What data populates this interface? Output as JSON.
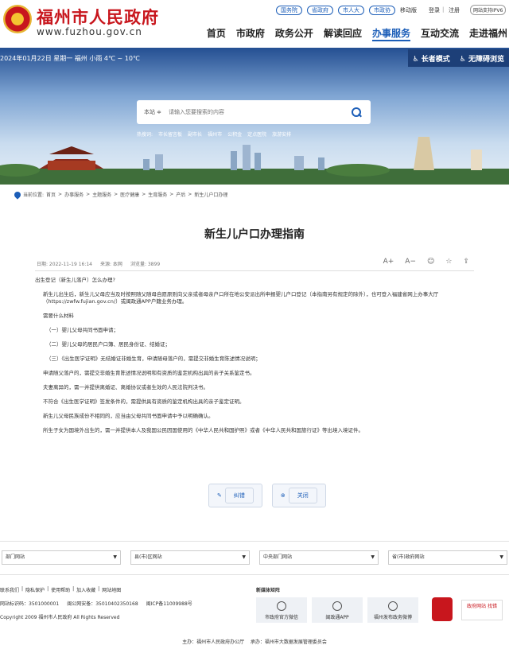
{
  "header": {
    "site_name": "福州市人民政府",
    "domain": "www.fuzhou.gov.cn",
    "ext_links": [
      "国务院",
      "省政府",
      "市人大",
      "市政协"
    ],
    "mobile": "移动版",
    "login": "登录",
    "register": "注册",
    "ipv6": "网站支持IPV6",
    "nav": [
      "首页",
      "市政府",
      "政务公开",
      "解读回应",
      "办事服务",
      "互动交流",
      "走进福州"
    ],
    "active_nav": "办事服务"
  },
  "banner": {
    "weather": "2024年01月22日 星期一 福州 小雨 4℃ ~ 10℃",
    "elder_mode": "长者模式",
    "accessible": "无障碍浏览",
    "search_scope": "本站 ≑",
    "search_placeholder": "请输入您要搜索的内容",
    "hot_label": "热搜词:",
    "hot_words": [
      "市长留言板",
      "副市长",
      "福州市",
      "公积金",
      "定点医院",
      "旅游安排"
    ]
  },
  "breadcrumb": {
    "label": "当前位置:",
    "items": [
      "首页",
      "办事服务",
      "主题服务",
      "医疗健康",
      "生育服务",
      "产后",
      "新生儿户口办理"
    ]
  },
  "article": {
    "title": "新生儿户口办理指南",
    "date": "日期: 2022-11-19 16:14",
    "source": "来源: 本网",
    "views": "浏览量: 3899",
    "tools": [
      "A+",
      "A−",
      "☺",
      "☆",
      "⇪"
    ],
    "q": "出生登记（新生儿落户）怎么办理?",
    "intro": "新生儿出生后，新生儿父母应当及时按照随父随母自愿原则向父亲或者母亲户口所在地公安派出所申报婴儿户口登记（本指南另有规定的除外），也可登入福建省网上办事大厅（https://zwfw.fujian.gov.cn/）或闽政通APP户籍业务办理。",
    "materials_title": "需要什么材料",
    "materials": [
      "（一）婴儿父母共同书面申请；",
      "（二）婴儿父母的居民户口簿、居民身份证、结婚证；",
      "（三）《出生医学证明》无结婚证非婚生育，申请随母落户的，需提交非婚生育陈述情况说明；"
    ],
    "notes": [
      "申请随父落户的，需提交非婚生育陈述情况说明和有资质的鉴定机构出具的亲子关系鉴定书。",
      "夫妻离异的，需一并提供离婚证、离婚协议或者生效的人民法院判决书。",
      "不符合《出生医学证明》签发条件的，需提供具有资质的鉴定机构出具的亲子鉴定证明。",
      "新生儿父母民族成份不相同的，应当由父母共同书面申请中予以明确确认。",
      "所生子女为国境外出生的，需一并提供本人及我国公民因国使用的《中华人民共和国护照》或者《中华人民共和国旅行证》等出境入境证件。"
    ],
    "btn_error": "纠错",
    "btn_close": "关闭"
  },
  "footer": {
    "selects": [
      "部门网站",
      "县(市)区网站",
      "中央部门网站",
      "省(市)政府网站"
    ],
    "links": [
      "联系我们",
      "隐私保护",
      "使用帮助",
      "加入收藏",
      "网站地图"
    ],
    "site_code": "网站标识码：3501000001",
    "police": "闽公网安备：35010402350168",
    "icp": "闽ICP备11009988号",
    "copyright": "Copyright 2009 福州市人民政府 All Rights Reserved",
    "new_media": "新媒体矩阵",
    "media": [
      "市政府官方微信",
      "闽政通APP",
      "福州发布政务微博"
    ],
    "badge_text": "政府网站 找错",
    "sponsor": "主办：福州市人民政府办公厅",
    "undertaker": "承办：福州市大数据发展管理委员会"
  }
}
